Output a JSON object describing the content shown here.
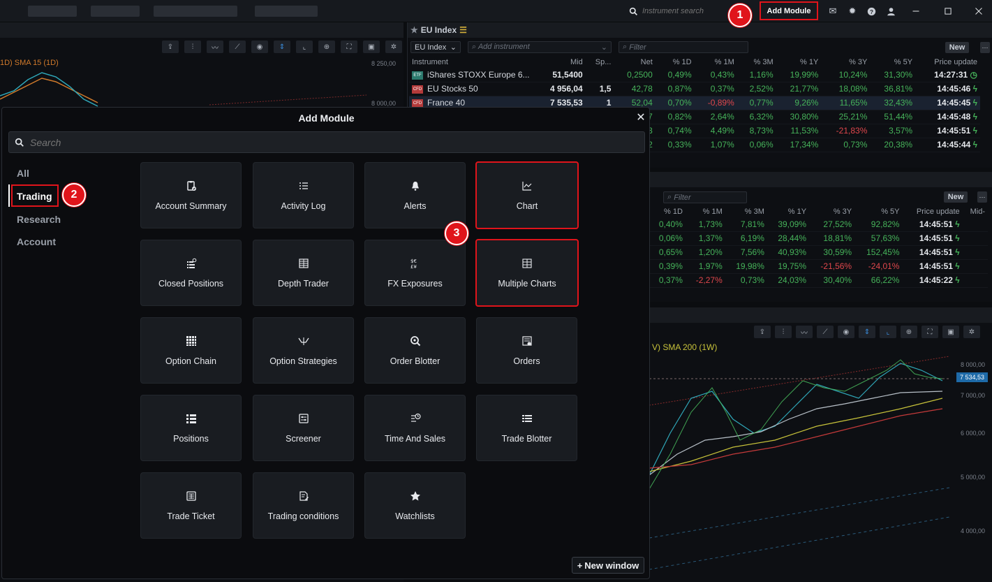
{
  "topbar": {
    "search_placeholder": "Instrument search",
    "add_module_label": "Add Module",
    "icons": [
      "mail-icon",
      "lightbulb-icon",
      "help-icon",
      "user-icon",
      "minimize-icon",
      "maximize-icon",
      "close-icon"
    ]
  },
  "steps": {
    "one": "1",
    "two": "2",
    "three": "3"
  },
  "left_chart": {
    "sma_label": "1D)  SMA 15 (1D)",
    "ticks": [
      "8 250,00",
      "8 000,00"
    ]
  },
  "eu_index": {
    "title": "EU Index",
    "list_select": "EU Index",
    "add_placeholder": "Add instrument",
    "filter_placeholder": "Filter",
    "new_label": "New",
    "columns": [
      "Instrument",
      "Mid",
      "Sp...",
      "Net",
      "% 1D",
      "% 1M",
      "% 3M",
      "% 1Y",
      "% 3Y",
      "% 5Y",
      "Price update"
    ],
    "rows": [
      {
        "type": "ETF",
        "name": "iShares STOXX Europe 6...",
        "mid": "51,5400",
        "sp": "",
        "net": "0,2500",
        "d1": "0,49%",
        "m1": "0,43%",
        "m3": "1,16%",
        "y1": "19,99%",
        "y3": "10,24%",
        "y5": "31,30%",
        "time": "14:27:31"
      },
      {
        "type": "CFD",
        "name": "EU Stocks 50",
        "mid": "4 956,04",
        "sp": "1,5",
        "net": "42,78",
        "d1": "0,87%",
        "m1": "0,37%",
        "m3": "2,52%",
        "y1": "21,77%",
        "y3": "18,08%",
        "y5": "36,81%",
        "time": "14:45:46"
      },
      {
        "type": "CFD",
        "name": "France 40",
        "mid": "7 535,53",
        "sp": "1",
        "net": "52,04",
        "d1": "0,70%",
        "m1": "-0,89%",
        "m3": "0,77%",
        "y1": "9,26%",
        "y3": "11,65%",
        "y5": "32,43%",
        "time": "14:45:45"
      },
      {
        "type": "",
        "name": "",
        "mid": "",
        "sp": "",
        "net": "7",
        "d1": "0,82%",
        "m1": "2,64%",
        "m3": "6,32%",
        "y1": "30,80%",
        "y3": "25,21%",
        "y5": "51,44%",
        "time": "14:45:48"
      },
      {
        "type": "",
        "name": "",
        "mid": "",
        "sp": "",
        "net": "3",
        "d1": "0,74%",
        "m1": "4,49%",
        "m3": "8,73%",
        "y1": "11,53%",
        "y3": "-21,83%",
        "y5": "3,57%",
        "time": "14:45:51"
      },
      {
        "type": "",
        "name": "",
        "mid": "",
        "sp": "",
        "net": "2",
        "d1": "0,33%",
        "m1": "1,07%",
        "m3": "0,06%",
        "y1": "17,34%",
        "y3": "0,73%",
        "y5": "20,38%",
        "time": "14:45:44"
      }
    ]
  },
  "second_list": {
    "filter_placeholder": "Filter",
    "new_label": "New",
    "columns": [
      "% 1D",
      "% 1M",
      "% 3M",
      "% 1Y",
      "% 3Y",
      "% 5Y",
      "Price update",
      "Mid-"
    ],
    "rows": [
      {
        "d1": "0,40%",
        "m1": "1,73%",
        "m3": "7,81%",
        "y1": "39,09%",
        "y3": "27,52%",
        "y5": "92,82%",
        "time": "14:45:51"
      },
      {
        "d1": "0,06%",
        "m1": "1,37%",
        "m3": "6,19%",
        "y1": "28,44%",
        "y3": "18,81%",
        "y5": "57,63%",
        "time": "14:45:51"
      },
      {
        "d1": "0,65%",
        "m1": "1,20%",
        "m3": "7,56%",
        "y1": "40,93%",
        "y3": "30,59%",
        "y5": "152,45%",
        "time": "14:45:51"
      },
      {
        "d1": "0,39%",
        "m1": "1,97%",
        "m3": "19,98%",
        "y1": "19,75%",
        "y3": "-21,56%",
        "y5": "-24,01%",
        "time": "14:45:51"
      },
      {
        "d1": "0,37%",
        "m1": "-2,27%",
        "m3": "0,73%",
        "y1": "24,03%",
        "y3": "30,40%",
        "y5": "66,22%",
        "time": "14:45:22"
      }
    ]
  },
  "lower_chart": {
    "sma_label": "V)  SMA 200 (1W)",
    "price_flag": "7 534,53",
    "ticks": [
      "8 000,00",
      "7 000,00",
      "6 000,00",
      "5 000,00",
      "4 000,00"
    ]
  },
  "modal": {
    "title": "Add Module",
    "search_placeholder": "Search",
    "categories": [
      "All",
      "Trading",
      "Research",
      "Account"
    ],
    "active_category": "Trading",
    "tiles": [
      {
        "label": "Account Summary",
        "icon": "clipboard-check-icon"
      },
      {
        "label": "Activity Log",
        "icon": "list-icon"
      },
      {
        "label": "Alerts",
        "icon": "bell-icon"
      },
      {
        "label": "Chart",
        "icon": "line-chart-icon"
      },
      {
        "label": "Closed Positions",
        "icon": "list-gear-icon"
      },
      {
        "label": "Depth Trader",
        "icon": "ladder-icon"
      },
      {
        "label": "FX Exposures",
        "icon": "currency-icon"
      },
      {
        "label": "Multiple Charts",
        "icon": "grid-charts-icon"
      },
      {
        "label": "Option Chain",
        "icon": "grid-icon"
      },
      {
        "label": "Option Strategies",
        "icon": "option-strategy-icon"
      },
      {
        "label": "Order Blotter",
        "icon": "zoom-icon"
      },
      {
        "label": "Orders",
        "icon": "orders-icon"
      },
      {
        "label": "Positions",
        "icon": "bulleted-list-icon"
      },
      {
        "label": "Screener",
        "icon": "screener-icon"
      },
      {
        "label": "Time And Sales",
        "icon": "clock-list-icon"
      },
      {
        "label": "Trade Blotter",
        "icon": "trade-list-icon"
      },
      {
        "label": "Trade Ticket",
        "icon": "ticket-icon"
      },
      {
        "label": "Trading conditions",
        "icon": "document-edit-icon"
      },
      {
        "label": "Watchlists",
        "icon": "star-icon"
      }
    ],
    "new_window_label": "New window"
  },
  "colors": {
    "accent_red": "#e0141b",
    "positive": "#46b35a",
    "negative": "#e0474c"
  }
}
